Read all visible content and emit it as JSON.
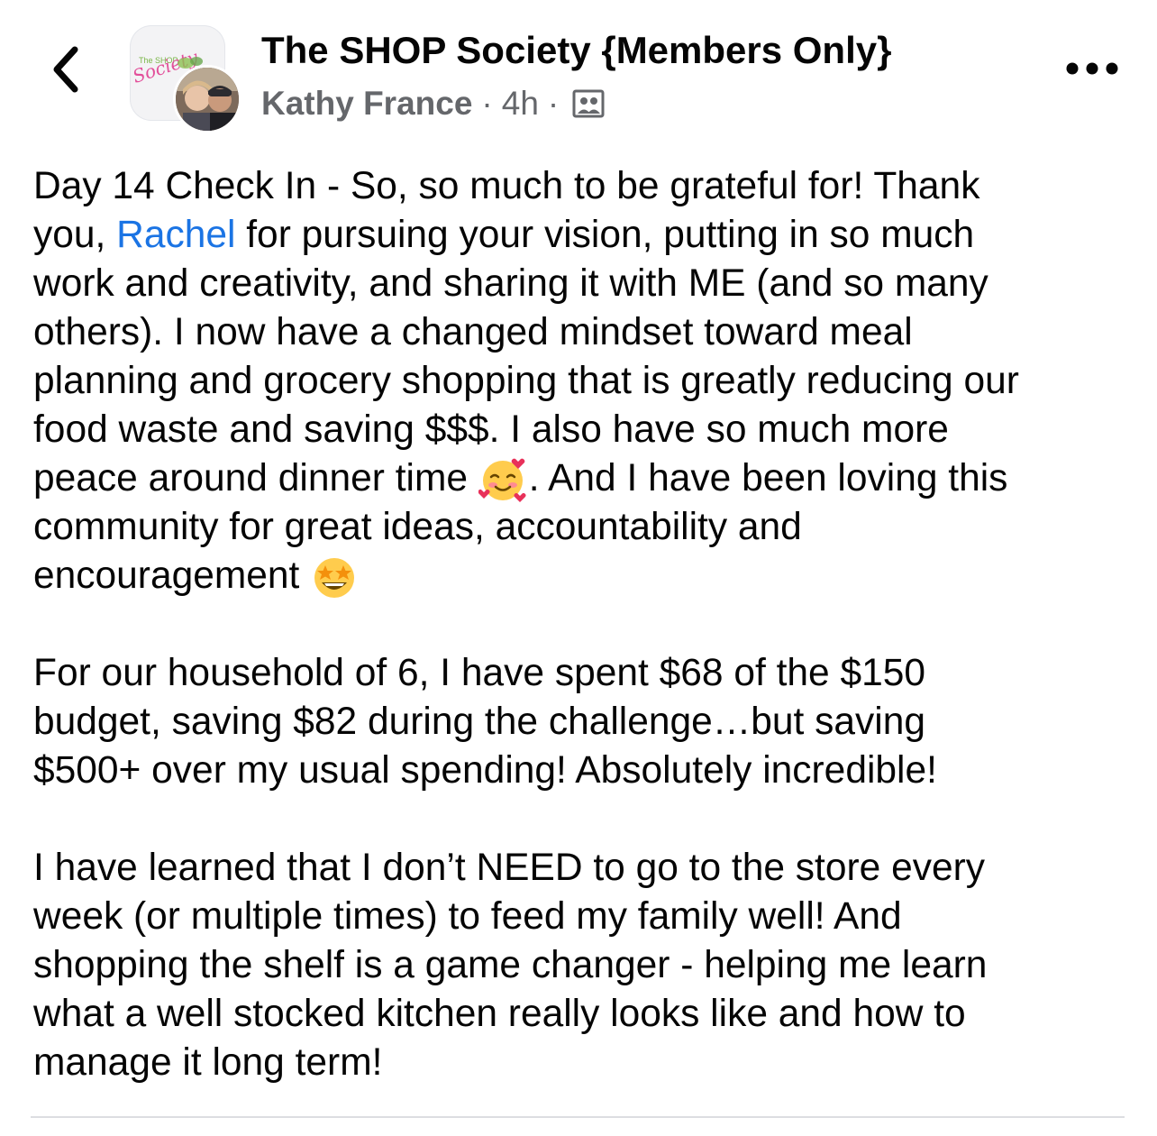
{
  "header": {
    "back_icon": "chevron-left-icon",
    "group_name": "The SHOP Society {Members Only}",
    "group_logo_text": "Society",
    "group_logo_small": "The SHOP",
    "author": "Kathy France",
    "separator": "·",
    "time": "4h",
    "privacy_icon": "members-group-icon",
    "more_icon": "more-dots-icon"
  },
  "post": {
    "paragraphs": [
      {
        "lines": [
          {
            "text": "Day 14 Check In - So, so much to be grateful for!  Thank"
          },
          {
            "pre": "you, ",
            "mention": "Rachel",
            "post": " for pursuing your vision, putting in so much"
          },
          {
            "text": "work and creativity, and sharing it with ME (and so many"
          },
          {
            "text": "others).  I now have a changed mindset toward meal"
          },
          {
            "text": "planning and grocery shopping that is greatly reducing our"
          },
          {
            "text": "food waste and saving $$$.  I also have so much more"
          },
          {
            "pre": "peace around dinner time ",
            "emoji": "smiling-face-with-hearts",
            "post": ". And I have been loving this"
          },
          {
            "text": "community for great ideas, accountability and"
          },
          {
            "pre": "encouragement ",
            "emoji": "star-struck",
            "post": ""
          }
        ]
      },
      {
        "lines": [
          {
            "text": "For our household of 6, I have spent $68 of the $150"
          },
          {
            "text": "budget, saving $82 during the challenge…but saving"
          },
          {
            "text": "$500+ over my usual spending!  Absolutely incredible!"
          }
        ]
      },
      {
        "lines": [
          {
            "text": "I have learned that I don’t NEED to go to the store every"
          },
          {
            "text": "week (or multiple times) to feed my family well!  And"
          },
          {
            "text": "shopping the shelf is a game changer - helping me learn"
          },
          {
            "text": "what a well stocked kitchen really looks like and how to"
          },
          {
            "text": "manage it long term!"
          }
        ]
      }
    ]
  },
  "colors": {
    "text": "#050505",
    "secondary_text": "#65676b",
    "mention": "#1b74e4",
    "divider": "#dcdde1"
  }
}
